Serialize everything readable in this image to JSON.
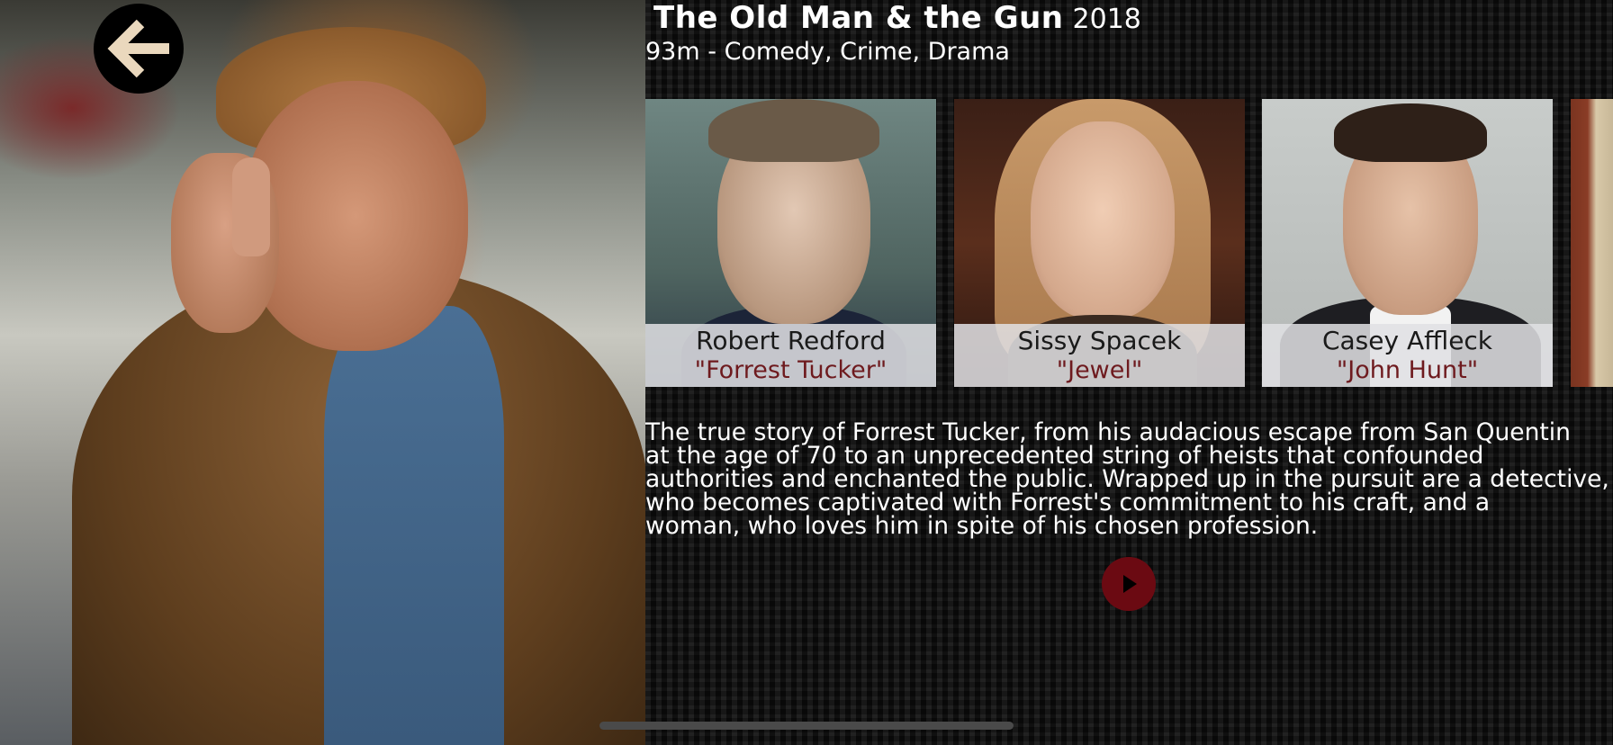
{
  "movie": {
    "title": "The Old Man & the Gun",
    "year": "2018",
    "meta": "93m - Comedy, Crime, Drama",
    "plot": "The true story of Forrest Tucker, from his audacious escape from San Quentin\nat the age of 70 to an unprecedented string of heists that confounded\nauthorities and enchanted the public. Wrapped up in the pursuit are a detective,\nwho becomes captivated with Forrest's commitment to his craft, and a\nwoman, who loves him in spite of his chosen profession."
  },
  "cast": [
    {
      "name": "Robert Redford",
      "role": "\"Forrest Tucker\""
    },
    {
      "name": "Sissy Spacek",
      "role": "\"Jewel\""
    },
    {
      "name": "Casey Affleck",
      "role": "\"John Hunt\""
    }
  ],
  "icons": {
    "back": "arrow-left-icon",
    "play": "play-icon"
  },
  "colors": {
    "accent_role": "#6e1a1e",
    "play_button": "#6b0a12",
    "back_arrow": "#ead8bd"
  }
}
